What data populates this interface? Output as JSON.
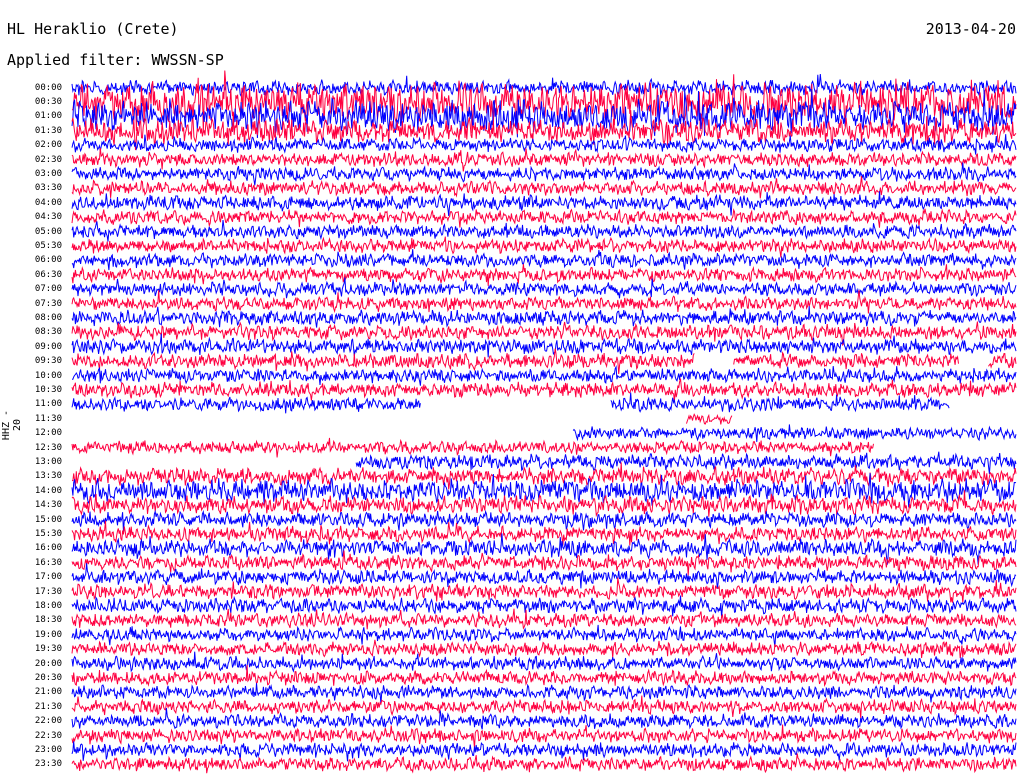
{
  "header": {
    "station": "HL Heraklio (Crete)",
    "date": "2013-04-20",
    "filter": "Applied filter: WWSSN-SP"
  },
  "chart_data": {
    "type": "line",
    "ylabel": "HHZ - 20",
    "colors": [
      "#0000ff",
      "#ff0040"
    ],
    "rows": [
      "00:00",
      "00:30",
      "01:00",
      "01:30",
      "02:00",
      "02:30",
      "03:00",
      "03:30",
      "04:00",
      "04:30",
      "05:00",
      "05:30",
      "06:00",
      "06:30",
      "07:00",
      "07:30",
      "08:00",
      "08:30",
      "09:00",
      "09:30",
      "10:00",
      "10:30",
      "11:00",
      "11:30",
      "12:00",
      "12:30",
      "13:00",
      "13:30",
      "14:00",
      "14:30",
      "15:00",
      "15:30",
      "16:00",
      "16:30",
      "17:00",
      "17:30",
      "18:00",
      "18:30",
      "19:00",
      "19:30",
      "20:00",
      "20:30",
      "21:00",
      "21:30",
      "22:00",
      "22:30",
      "23:00",
      "23:30"
    ],
    "row_amplitude": [
      0.6,
      1.6,
      1.3,
      1.0,
      0.55,
      0.55,
      0.55,
      0.55,
      0.6,
      0.55,
      0.55,
      0.55,
      0.55,
      0.55,
      0.55,
      0.55,
      0.6,
      0.6,
      0.6,
      0.6,
      0.55,
      0.6,
      0.55,
      0.4,
      0.5,
      0.5,
      0.6,
      0.7,
      0.9,
      0.7,
      0.6,
      0.6,
      0.7,
      0.6,
      0.6,
      0.6,
      0.6,
      0.55,
      0.55,
      0.55,
      0.55,
      0.55,
      0.55,
      0.55,
      0.55,
      0.55,
      0.55,
      0.55
    ],
    "data_gaps": [
      {
        "row": 22,
        "from": 0.37,
        "to": 0.57
      },
      {
        "row": 22,
        "from": 0.93,
        "to": 1.0
      },
      {
        "row": 23,
        "from": 0.0,
        "to": 0.65
      },
      {
        "row": 23,
        "from": 0.7,
        "to": 1.0
      },
      {
        "row": 24,
        "from": 0.0,
        "to": 0.53
      },
      {
        "row": 25,
        "from": 0.85,
        "to": 1.0
      },
      {
        "row": 26,
        "from": 0.0,
        "to": 0.3
      },
      {
        "row": 19,
        "from": 0.66,
        "to": 0.7
      },
      {
        "row": 19,
        "from": 0.94,
        "to": 0.97
      }
    ]
  }
}
